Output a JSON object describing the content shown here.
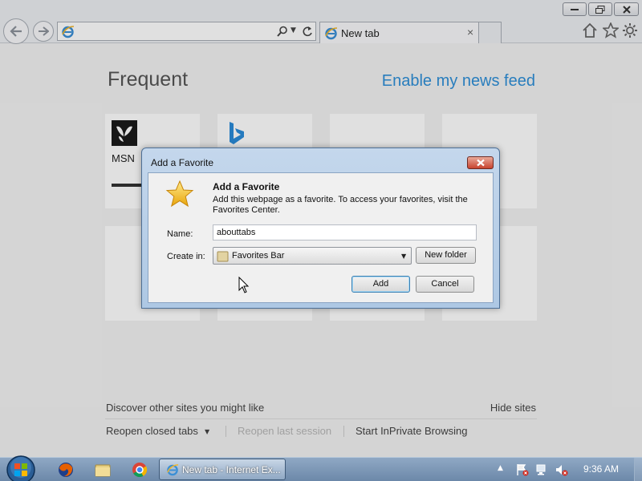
{
  "browser": {
    "address_value": "",
    "tab_title": "New tab",
    "tab_close": "×"
  },
  "newtab_page": {
    "frequent_heading": "Frequent",
    "news_feed_link": "Enable my news feed",
    "tiles": [
      {
        "label": "MSN",
        "icon": "msn-butterfly-icon"
      },
      {
        "label": "",
        "icon": "bing-icon"
      },
      {
        "label": ""
      },
      {
        "label": ""
      },
      {
        "label": ""
      },
      {
        "label": ""
      },
      {
        "label": ""
      },
      {
        "label": ""
      }
    ],
    "discover_text": "Discover other sites you might like",
    "hide_sites": "Hide sites",
    "reopen_closed_tabs": "Reopen closed tabs",
    "reopen_last_session": "Reopen last session",
    "start_inprivate": "Start InPrivate Browsing"
  },
  "dialog": {
    "title": "Add a Favorite",
    "heading": "Add a Favorite",
    "description": "Add this webpage as a favorite. To access your favorites, visit the Favorites Center.",
    "name_label": "Name:",
    "name_value": "abouttabs",
    "create_in_label": "Create in:",
    "create_in_value": "Favorites Bar",
    "new_folder_button": "New folder",
    "add_button": "Add",
    "cancel_button": "Cancel"
  },
  "taskbar": {
    "active_task": "New tab - Internet Ex...",
    "clock": "9:36 AM",
    "pinned": [
      "firefox-icon",
      "explorer-folder-icon",
      "chrome-icon"
    ]
  },
  "colors": {
    "link_blue": "#2e8fd8",
    "dialog_frame": "#aec8e4",
    "taskbar": "#6c88a9"
  }
}
